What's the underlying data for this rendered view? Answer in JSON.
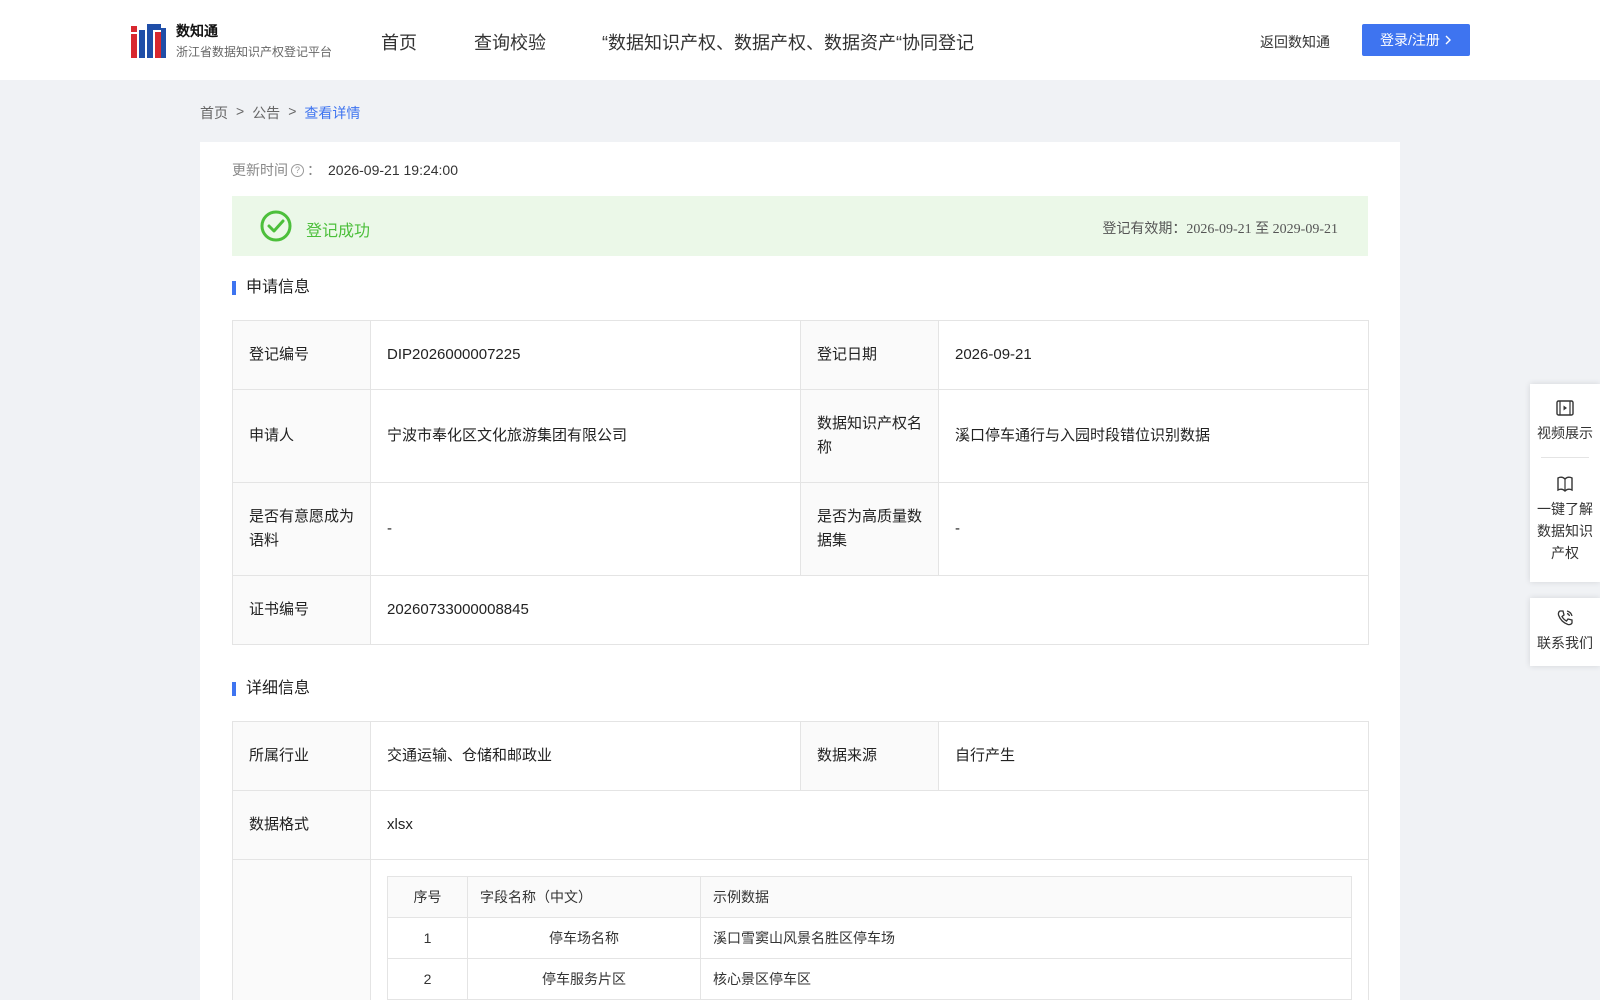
{
  "header": {
    "logo_title": "数知通",
    "logo_subtitle": "浙江省数据知识产权登记平台",
    "nav": [
      "首页",
      "查询校验",
      "“数据知识产权、数据产权、数据资产“协同登记"
    ],
    "back_link": "返回数知通",
    "login_label": "登录/注册"
  },
  "breadcrumb": {
    "items": [
      "首页",
      "公告",
      "查看详情"
    ],
    "separator": ">"
  },
  "update": {
    "label": "更新时间",
    "colon": "：",
    "value": "2026-09-21 19:24:00"
  },
  "status": {
    "text": "登记成功",
    "validity": "登记有效期：2026-09-21 至 2029-09-21"
  },
  "application": {
    "title": "申请信息",
    "reg_no_label": "登记编号",
    "reg_no": "DIP2026000007225",
    "reg_date_label": "登记日期",
    "reg_date": "2026-09-21",
    "applicant_label": "申请人",
    "applicant": "宁波市奉化区文化旅游集团有限公司",
    "ip_name_label": "数据知识产权名称",
    "ip_name": "溪口停车通行与入园时段错位识别数据",
    "corpus_label": "是否有意愿成为语料",
    "corpus": "-",
    "quality_label": "是否为高质量数据集",
    "quality": "-",
    "cert_label": "证书编号",
    "cert": "20260733000008845"
  },
  "detail": {
    "title": "详细信息",
    "industry_label": "所属行业",
    "industry": "交通运输、仓储和邮政业",
    "source_label": "数据来源",
    "source": "自行产生",
    "format_label": "数据格式",
    "format": "xlsx",
    "fields_headers": [
      "序号",
      "字段名称（中文）",
      "示例数据"
    ],
    "fields_rows": [
      [
        "1",
        "停车场名称",
        "溪口雪窦山风景名胜区停车场"
      ],
      [
        "2",
        "停车服务片区",
        "核心景区停车区"
      ]
    ]
  },
  "side": {
    "video": "视频展示",
    "learn": "一键了解数据知识产权",
    "contact": "联系我们"
  },
  "colors": {
    "accent": "#3e74f0",
    "success": "#4cbf3b",
    "success_bg": "#ebf8e8"
  }
}
